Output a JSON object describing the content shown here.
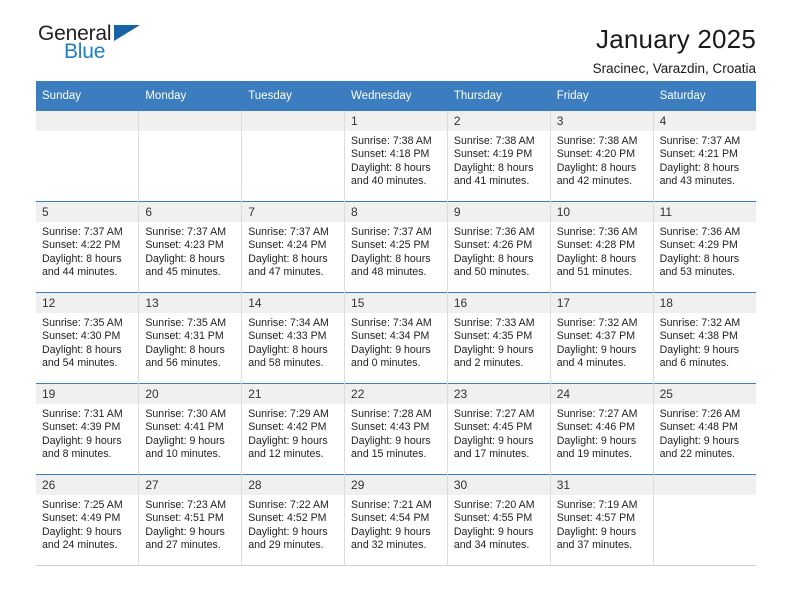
{
  "brand": {
    "name_part1": "General",
    "name_part2": "Blue",
    "triangle_color": "#1763a5",
    "blue_color": "#1f7fc4"
  },
  "header": {
    "title": "January 2025",
    "subtitle": "Sracinec, Varazdin, Croatia"
  },
  "theme": {
    "header_row_bg": "#3b7dbf",
    "daynum_bg": "#f0f0f0",
    "grid_line": "#dcdcdc"
  },
  "weekday_headers": [
    "Sunday",
    "Monday",
    "Tuesday",
    "Wednesday",
    "Thursday",
    "Friday",
    "Saturday"
  ],
  "weeks": [
    [
      {
        "day": "",
        "empty": true,
        "l1": "",
        "l2": "",
        "l3": "",
        "l4": ""
      },
      {
        "day": "",
        "empty": true,
        "l1": "",
        "l2": "",
        "l3": "",
        "l4": ""
      },
      {
        "day": "",
        "empty": true,
        "l1": "",
        "l2": "",
        "l3": "",
        "l4": ""
      },
      {
        "day": "1",
        "l1": "Sunrise: 7:38 AM",
        "l2": "Sunset: 4:18 PM",
        "l3": "Daylight: 8 hours",
        "l4": "and 40 minutes."
      },
      {
        "day": "2",
        "l1": "Sunrise: 7:38 AM",
        "l2": "Sunset: 4:19 PM",
        "l3": "Daylight: 8 hours",
        "l4": "and 41 minutes."
      },
      {
        "day": "3",
        "l1": "Sunrise: 7:38 AM",
        "l2": "Sunset: 4:20 PM",
        "l3": "Daylight: 8 hours",
        "l4": "and 42 minutes."
      },
      {
        "day": "4",
        "l1": "Sunrise: 7:37 AM",
        "l2": "Sunset: 4:21 PM",
        "l3": "Daylight: 8 hours",
        "l4": "and 43 minutes."
      }
    ],
    [
      {
        "day": "5",
        "l1": "Sunrise: 7:37 AM",
        "l2": "Sunset: 4:22 PM",
        "l3": "Daylight: 8 hours",
        "l4": "and 44 minutes."
      },
      {
        "day": "6",
        "l1": "Sunrise: 7:37 AM",
        "l2": "Sunset: 4:23 PM",
        "l3": "Daylight: 8 hours",
        "l4": "and 45 minutes."
      },
      {
        "day": "7",
        "l1": "Sunrise: 7:37 AM",
        "l2": "Sunset: 4:24 PM",
        "l3": "Daylight: 8 hours",
        "l4": "and 47 minutes."
      },
      {
        "day": "8",
        "l1": "Sunrise: 7:37 AM",
        "l2": "Sunset: 4:25 PM",
        "l3": "Daylight: 8 hours",
        "l4": "and 48 minutes."
      },
      {
        "day": "9",
        "l1": "Sunrise: 7:36 AM",
        "l2": "Sunset: 4:26 PM",
        "l3": "Daylight: 8 hours",
        "l4": "and 50 minutes."
      },
      {
        "day": "10",
        "l1": "Sunrise: 7:36 AM",
        "l2": "Sunset: 4:28 PM",
        "l3": "Daylight: 8 hours",
        "l4": "and 51 minutes."
      },
      {
        "day": "11",
        "l1": "Sunrise: 7:36 AM",
        "l2": "Sunset: 4:29 PM",
        "l3": "Daylight: 8 hours",
        "l4": "and 53 minutes."
      }
    ],
    [
      {
        "day": "12",
        "l1": "Sunrise: 7:35 AM",
        "l2": "Sunset: 4:30 PM",
        "l3": "Daylight: 8 hours",
        "l4": "and 54 minutes."
      },
      {
        "day": "13",
        "l1": "Sunrise: 7:35 AM",
        "l2": "Sunset: 4:31 PM",
        "l3": "Daylight: 8 hours",
        "l4": "and 56 minutes."
      },
      {
        "day": "14",
        "l1": "Sunrise: 7:34 AM",
        "l2": "Sunset: 4:33 PM",
        "l3": "Daylight: 8 hours",
        "l4": "and 58 minutes."
      },
      {
        "day": "15",
        "l1": "Sunrise: 7:34 AM",
        "l2": "Sunset: 4:34 PM",
        "l3": "Daylight: 9 hours",
        "l4": "and 0 minutes."
      },
      {
        "day": "16",
        "l1": "Sunrise: 7:33 AM",
        "l2": "Sunset: 4:35 PM",
        "l3": "Daylight: 9 hours",
        "l4": "and 2 minutes."
      },
      {
        "day": "17",
        "l1": "Sunrise: 7:32 AM",
        "l2": "Sunset: 4:37 PM",
        "l3": "Daylight: 9 hours",
        "l4": "and 4 minutes."
      },
      {
        "day": "18",
        "l1": "Sunrise: 7:32 AM",
        "l2": "Sunset: 4:38 PM",
        "l3": "Daylight: 9 hours",
        "l4": "and 6 minutes."
      }
    ],
    [
      {
        "day": "19",
        "l1": "Sunrise: 7:31 AM",
        "l2": "Sunset: 4:39 PM",
        "l3": "Daylight: 9 hours",
        "l4": "and 8 minutes."
      },
      {
        "day": "20",
        "l1": "Sunrise: 7:30 AM",
        "l2": "Sunset: 4:41 PM",
        "l3": "Daylight: 9 hours",
        "l4": "and 10 minutes."
      },
      {
        "day": "21",
        "l1": "Sunrise: 7:29 AM",
        "l2": "Sunset: 4:42 PM",
        "l3": "Daylight: 9 hours",
        "l4": "and 12 minutes."
      },
      {
        "day": "22",
        "l1": "Sunrise: 7:28 AM",
        "l2": "Sunset: 4:43 PM",
        "l3": "Daylight: 9 hours",
        "l4": "and 15 minutes."
      },
      {
        "day": "23",
        "l1": "Sunrise: 7:27 AM",
        "l2": "Sunset: 4:45 PM",
        "l3": "Daylight: 9 hours",
        "l4": "and 17 minutes."
      },
      {
        "day": "24",
        "l1": "Sunrise: 7:27 AM",
        "l2": "Sunset: 4:46 PM",
        "l3": "Daylight: 9 hours",
        "l4": "and 19 minutes."
      },
      {
        "day": "25",
        "l1": "Sunrise: 7:26 AM",
        "l2": "Sunset: 4:48 PM",
        "l3": "Daylight: 9 hours",
        "l4": "and 22 minutes."
      }
    ],
    [
      {
        "day": "26",
        "l1": "Sunrise: 7:25 AM",
        "l2": "Sunset: 4:49 PM",
        "l3": "Daylight: 9 hours",
        "l4": "and 24 minutes."
      },
      {
        "day": "27",
        "l1": "Sunrise: 7:23 AM",
        "l2": "Sunset: 4:51 PM",
        "l3": "Daylight: 9 hours",
        "l4": "and 27 minutes."
      },
      {
        "day": "28",
        "l1": "Sunrise: 7:22 AM",
        "l2": "Sunset: 4:52 PM",
        "l3": "Daylight: 9 hours",
        "l4": "and 29 minutes."
      },
      {
        "day": "29",
        "l1": "Sunrise: 7:21 AM",
        "l2": "Sunset: 4:54 PM",
        "l3": "Daylight: 9 hours",
        "l4": "and 32 minutes."
      },
      {
        "day": "30",
        "l1": "Sunrise: 7:20 AM",
        "l2": "Sunset: 4:55 PM",
        "l3": "Daylight: 9 hours",
        "l4": "and 34 minutes."
      },
      {
        "day": "31",
        "l1": "Sunrise: 7:19 AM",
        "l2": "Sunset: 4:57 PM",
        "l3": "Daylight: 9 hours",
        "l4": "and 37 minutes."
      },
      {
        "day": "",
        "empty": true,
        "l1": "",
        "l2": "",
        "l3": "",
        "l4": ""
      }
    ]
  ]
}
